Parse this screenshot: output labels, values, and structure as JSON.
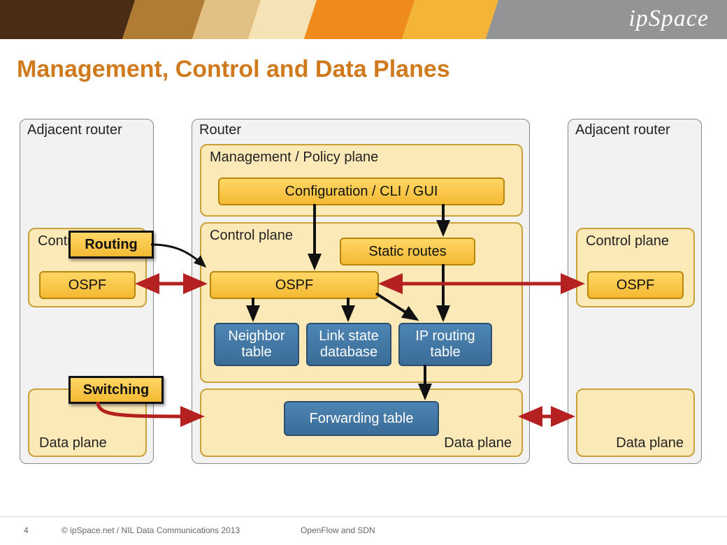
{
  "header": {
    "logo": "ipSpace"
  },
  "title": "Management, Control and Data Planes",
  "footer": {
    "page": "4",
    "copyright": "© ipSpace.net / NIL Data Communications 2013",
    "topic": "OpenFlow and SDN"
  },
  "left_router": {
    "title": "Adjacent router",
    "control_label": "Control plane",
    "ospf": "OSPF",
    "data_label": "Data plane"
  },
  "right_router": {
    "title": "Adjacent router",
    "control_label": "Control plane",
    "ospf": "OSPF",
    "data_label": "Data plane"
  },
  "center_router": {
    "title": "Router",
    "mgmt": {
      "label": "Management / Policy plane",
      "config": "Configuration / CLI / GUI"
    },
    "control": {
      "label": "Control plane",
      "ospf": "OSPF",
      "static": "Static routes",
      "neighbor": "Neighbor table",
      "lsdb": "Link state database",
      "iprt": "IP routing table"
    },
    "data": {
      "label": "Data plane",
      "fwd": "Forwarding table"
    }
  },
  "callouts": {
    "routing": "Routing",
    "switching": "Switching"
  }
}
